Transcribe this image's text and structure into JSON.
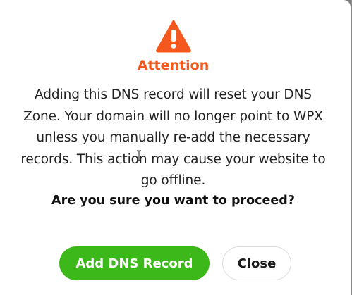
{
  "dialog": {
    "title": "Attention",
    "message": "Adding this DNS record will reset your DNS Zone. Your domain will no longer point to WPX unless you manually re-add the necessary records. This action may cause your website to go offline.",
    "question": "Are you sure you want to proceed?",
    "icon": "warning-triangle-icon"
  },
  "buttons": {
    "confirm_label": "Add DNS Record",
    "close_label": "Close"
  },
  "colors": {
    "accent": "#f4581f",
    "confirm": "#3cb81a"
  }
}
